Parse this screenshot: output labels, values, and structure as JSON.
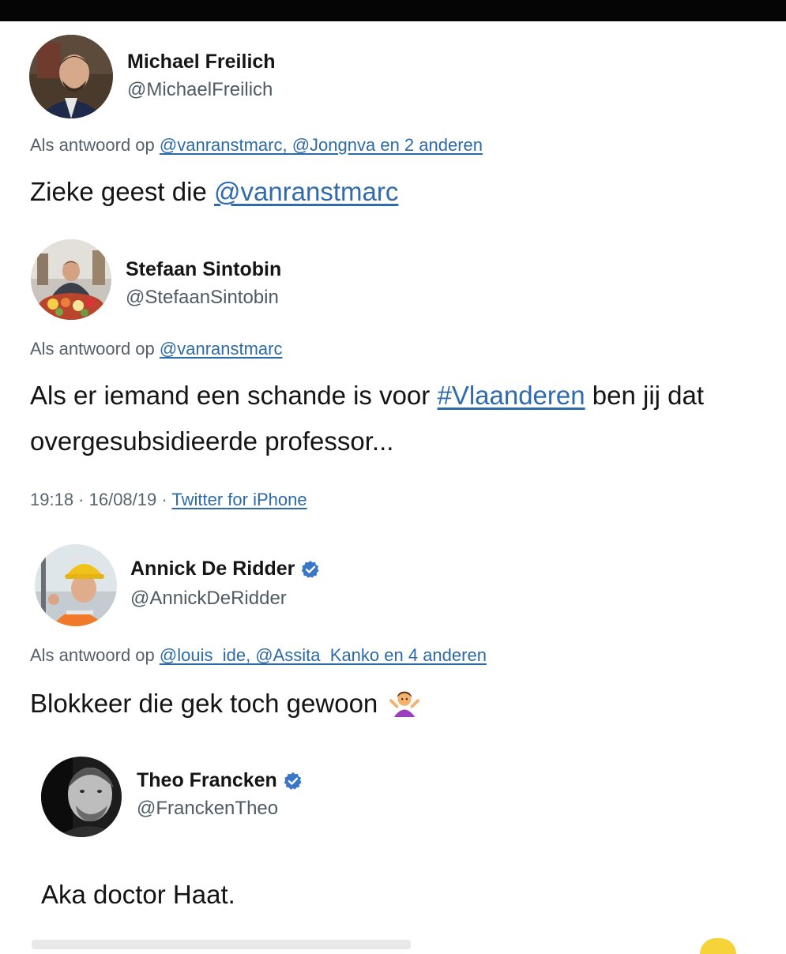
{
  "tweets": [
    {
      "name": "Michael Freilich",
      "handle": "@MichaelFreilich",
      "verified": false,
      "reply_prefix": "Als antwoord op",
      "reply_mentions": "@vanranstmarc, @Jongnva en 2 anderen",
      "text_plain": "Zieke geest die ",
      "text_link": "@vanranstmarc",
      "avatar": "portrait-man-suit"
    },
    {
      "name": "Stefaan Sintobin",
      "handle": "@StefaanSintobin",
      "verified": false,
      "reply_prefix": "Als antwoord op",
      "reply_mentions": "@vanranstmarc",
      "line1_before": "Als er iemand een schande is voor ",
      "line1_link": "#Vlaanderen",
      "line1_after": " ben jij dat",
      "line2": "overgesubsidieerde professor...",
      "time": "19:18 · 16/08/19 · ",
      "source": "Twitter for iPhone",
      "avatar": "portrait-man-flowers"
    },
    {
      "name": "Annick De Ridder",
      "handle": "@AnnickDeRidder",
      "verified": true,
      "reply_prefix": "Als antwoord op",
      "reply_mentions": "@louis_ide, @Assita_Kanko en 4 anderen",
      "text_plain": "Blokkeer die gek toch gewoon",
      "emoji": "person-shrugging-emoji",
      "avatar": "portrait-woman-hardhat"
    },
    {
      "name": "Theo Francken",
      "handle": "@FranckenTheo",
      "verified": true,
      "text_plain": "Aka doctor Haat.",
      "avatar": "portrait-man-bw"
    }
  ],
  "colors": {
    "link": "#2f6bad",
    "verified": "#3b77c9",
    "secondary_text": "#56606a"
  }
}
